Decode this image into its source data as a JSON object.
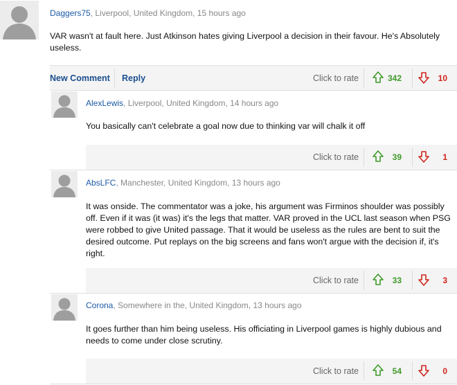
{
  "comments": [
    {
      "author": "Daggers75",
      "meta": ", Liverpool, United Kingdom, 15 hours ago",
      "body": "VAR wasn't at fault here. Just Atkinson hates giving Liverpool a decision in their favour. He's Absolutely useless.",
      "up": "342",
      "down": "10"
    },
    {
      "author": "AlexLewis",
      "meta": ", Liverpool, United Kingdom, 14 hours ago",
      "body": "You basically can't celebrate a goal now due to thinking var will chalk it off",
      "up": "39",
      "down": "1"
    },
    {
      "author": "AbsLFC",
      "meta": ", Manchester, United Kingdom, 13 hours ago",
      "body": "It was onside. The commentator was a joke, his argument was Firminos shoulder was possibly off. Even if it was (it was) it's the legs that matter. VAR proved in the UCL last season when PSG were robbed to give United passage. That it would be useless as the rules are bent to suit the desired outcome. Put replays on the big screens and fans won't argue with the decision if, it's right.",
      "up": "33",
      "down": "3"
    },
    {
      "author": "Corona",
      "meta": ", Somewhere in the, United Kingdom, 13 hours ago",
      "body": "It goes further than him being useless. His officiating in Liverpool games is highly dubious and needs to come under close scrutiny.",
      "up": "54",
      "down": "0"
    }
  ],
  "actions": {
    "new_comment": "New Comment",
    "reply": "Reply",
    "click_to_rate": "Click to rate"
  },
  "colors": {
    "author": "#1c5aa6",
    "up": "#3f9a2a",
    "down": "#d0241c"
  },
  "icons": {
    "avatar": "avatar-placeholder-icon",
    "up": "arrow-up-icon",
    "down": "arrow-down-icon"
  }
}
